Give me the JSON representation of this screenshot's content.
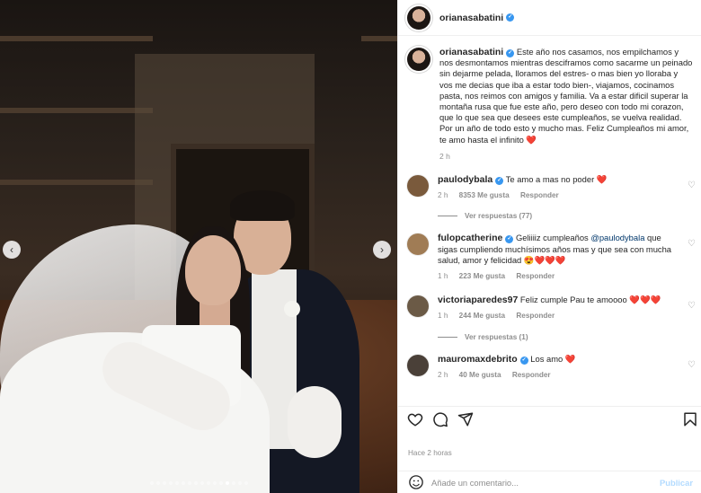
{
  "post": {
    "username": "orianasabatini",
    "caption": "Este año nos casamos, nos empilchamos y nos desmontamos mientras desciframos como sacarme un peinado sin dejarme pelada, lloramos del estres- o mas bien yo lloraba y vos me decias que iba a estar todo bien-, viajamos, cocinamos pasta, nos reimos con amigos y familia. Va a estar dificil superar la montaña rusa que fue este año, pero deseo con todo mi corazon, que lo que sea que desees este cumpleaños, se vuelva realidad. Por un año de todo esto y mucho mas. Feliz Cumpleaños mi amor, te amo hasta el infinito",
    "caption_emoji": "❤️",
    "caption_time": "2 h",
    "time_ago": "Hace 2 horas",
    "carousel_total": 16,
    "carousel_active": 13
  },
  "comments": [
    {
      "username": "paulodybala",
      "text": "Te amo a mas no poder",
      "emoji": "❤️",
      "time": "2 h",
      "likes": "8353 Me gusta",
      "reply": "Responder",
      "view_replies": "Ver respuestas (77)",
      "avatar_color": "#7a5a3c"
    },
    {
      "username": "fulopcatherine",
      "text_before": "Geliiiiz cumpleaños ",
      "mention": "@paulodybala",
      "text_after": " que sigas cumpliendo muchísimos años mas y que sea con mucha salud, amor y felicidad",
      "emoji": "😍❤️❤️❤️",
      "time": "1 h",
      "likes": "223 Me gusta",
      "reply": "Responder",
      "avatar_color": "#a07c55"
    },
    {
      "username": "victoriaparedes97",
      "text": "Feliz cumple Pau te amoooo",
      "emoji": "❤️❤️❤️",
      "time": "1 h",
      "likes": "244 Me gusta",
      "reply": "Responder",
      "view_replies": "Ver respuestas (1)",
      "avatar_color": "#6b5a46"
    },
    {
      "username": "mauromaxdebrito",
      "text": "Los amo",
      "emoji": "❤️",
      "time": "2 h",
      "likes": "40 Me gusta",
      "reply": "Responder",
      "avatar_color": "#4a4038"
    }
  ],
  "add_comment": {
    "emoji_icon": "smiley-icon",
    "placeholder": "Añade un comentario...",
    "publish": "Publicar"
  },
  "icons": [
    "heart-icon",
    "comment-icon",
    "share-icon",
    "bookmark-icon",
    "chevron-left-icon",
    "chevron-right-icon",
    "verified-icon"
  ],
  "colors": {
    "verified": "#3897f0",
    "heart": "#ed4956",
    "muted": "#8e8e8e",
    "link": "#00376b",
    "publish": "#b3dbff"
  }
}
